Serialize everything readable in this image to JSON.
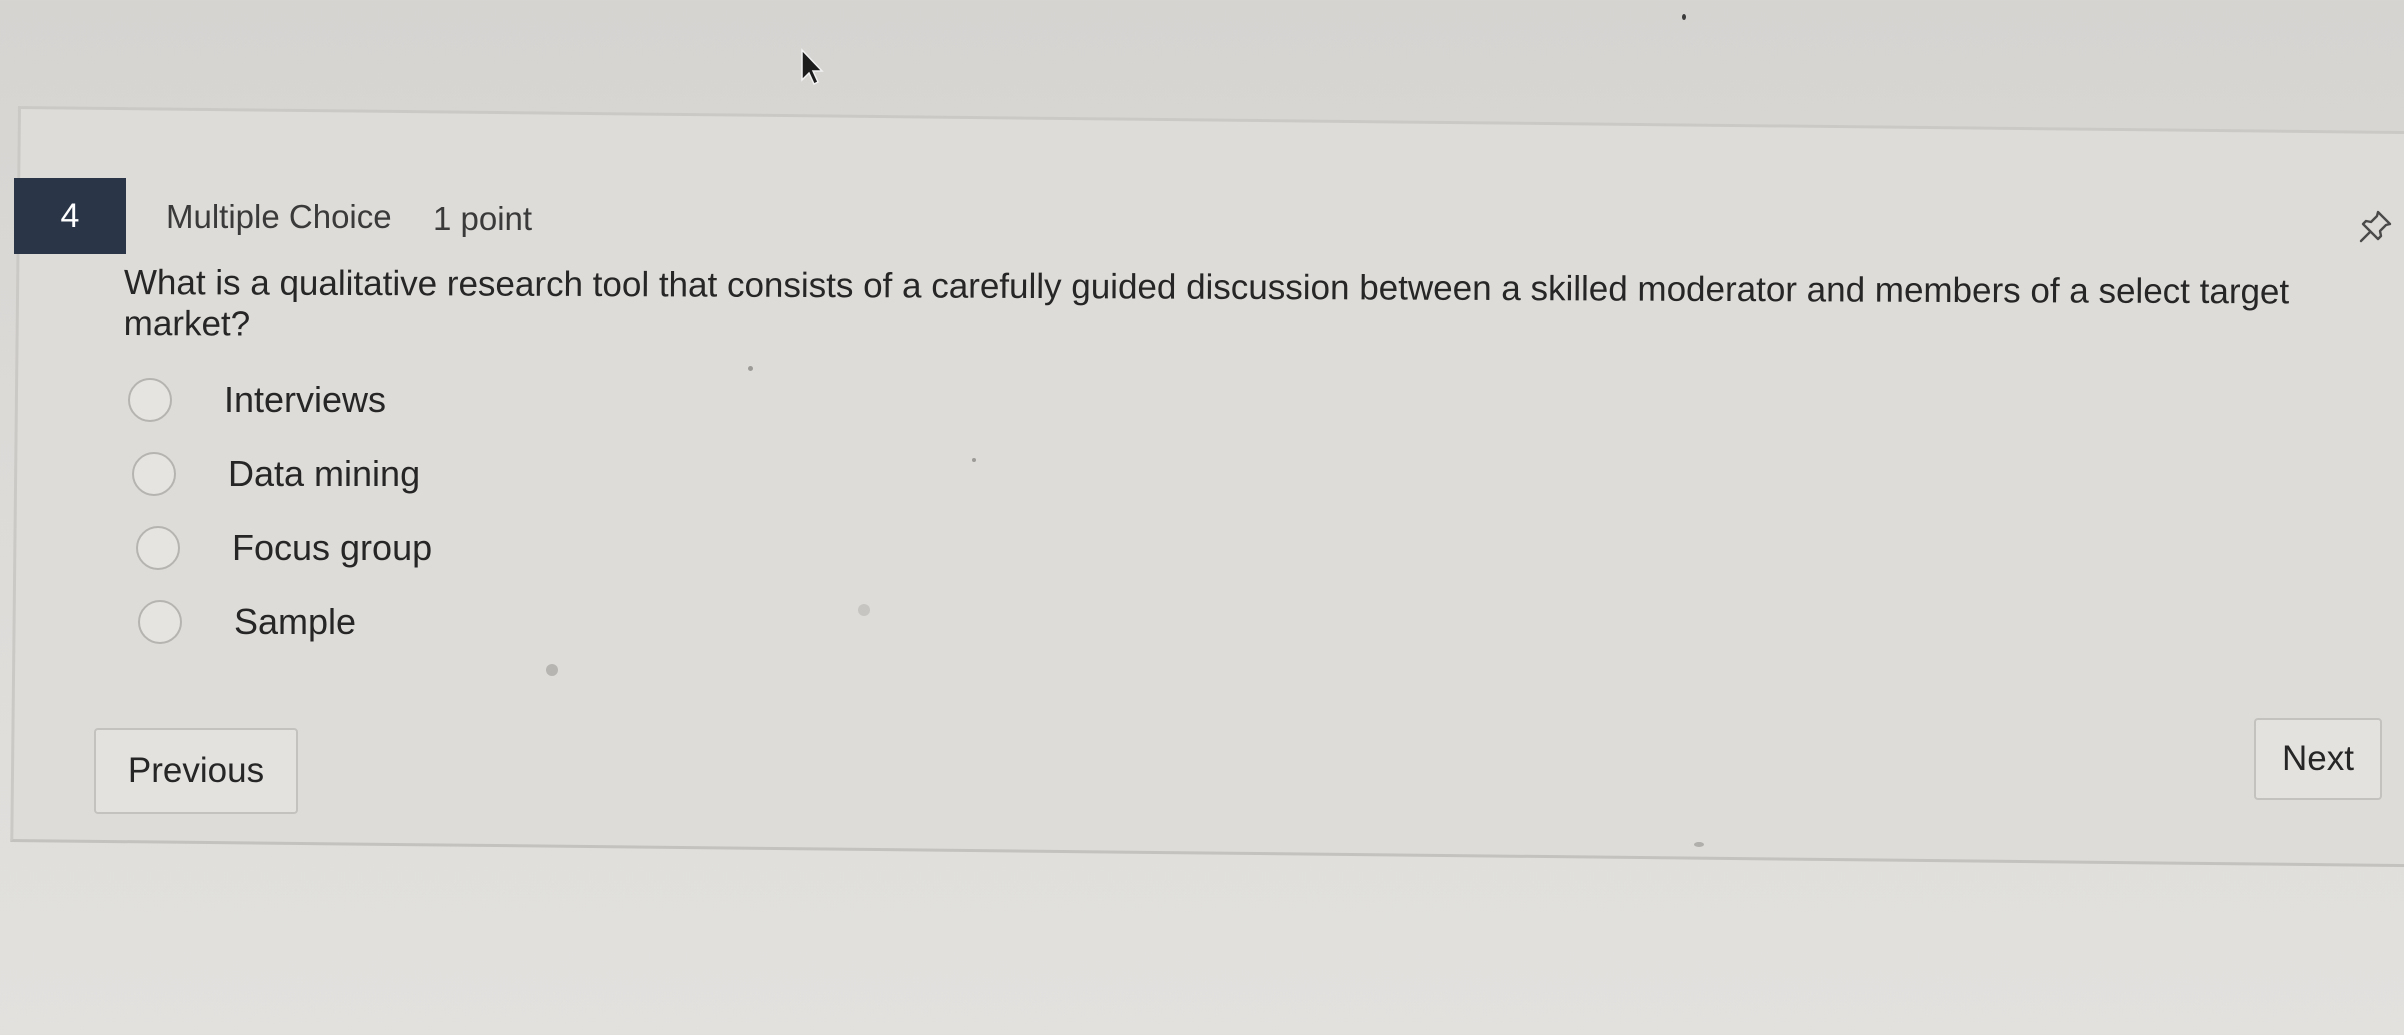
{
  "question": {
    "number": "4",
    "type": "Multiple Choice",
    "points": "1 point",
    "text": "What is a qualitative research tool that consists of a carefully guided discussion between a skilled moderator and members of a select target market?"
  },
  "options": [
    {
      "label": "Interviews"
    },
    {
      "label": "Data mining"
    },
    {
      "label": "Focus group"
    },
    {
      "label": "Sample"
    }
  ],
  "nav": {
    "previous_label": "Previous",
    "next_label": "Next"
  },
  "icons": {
    "pin": "pin-icon",
    "cursor": "mouse-cursor-icon"
  }
}
